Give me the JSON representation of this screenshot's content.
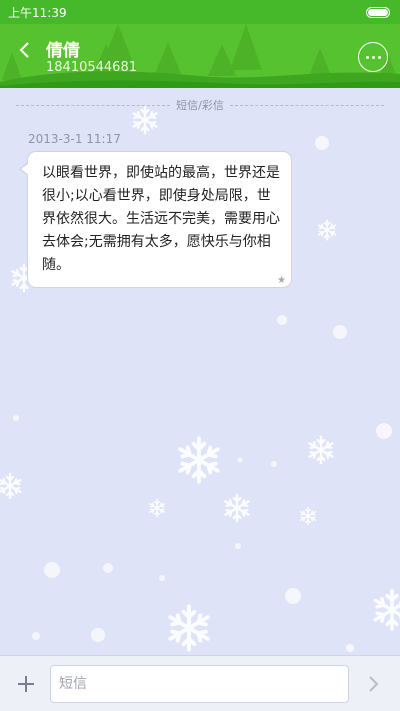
{
  "status_bar": {
    "time": "上午11:39",
    "battery_icon": "battery-icon"
  },
  "header": {
    "back_icon": "chevron-left-icon",
    "contact_name": "倩倩",
    "contact_number": "18410544681",
    "more_icon": "more-dots-icon",
    "colors": {
      "primary": "#57c22f",
      "status": "#46b92a"
    }
  },
  "conversation": {
    "divider_label": "短信/彩信",
    "messages": [
      {
        "timestamp": "2013-3-1 11:17",
        "text": "以眼看世界，即使站的最高，世界还是很小;以心看世界，即使身处局限，世界依然很大。生活远不完美，需要用心去体会;无需拥有太多，愿快乐与你相随。",
        "status_icon": "star-icon"
      }
    ]
  },
  "input_bar": {
    "add_icon": "plus-icon",
    "placeholder": "短信",
    "value": "",
    "send_icon": "send-chevron-icon"
  }
}
